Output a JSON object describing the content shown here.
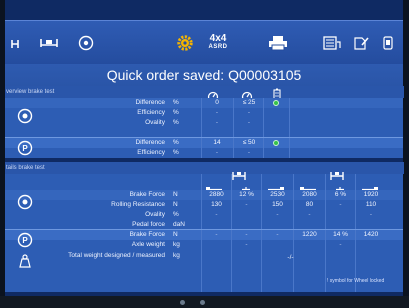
{
  "toolbar": {
    "items": [
      {
        "icon": "lift-icon"
      },
      {
        "icon": "vehicle-axle-icon"
      },
      {
        "icon": "brake-disc-icon"
      },
      {
        "icon": "gear-icon"
      },
      {
        "icon": "4x4-asrd-logo",
        "label_top": "4x4",
        "label_bottom": "ASRD"
      },
      {
        "icon": "printer-icon"
      },
      {
        "icon": "list-icon"
      },
      {
        "icon": "document-edit-icon"
      },
      {
        "icon": "phone-icon"
      }
    ],
    "accent": "#f5b400"
  },
  "title": "Quick order saved: Q00003105",
  "overview": {
    "heading": "verview brake test",
    "rows": [
      {
        "label": "Difference",
        "unit": "%",
        "c1": "0",
        "c2": "≤ 25",
        "status": "green"
      },
      {
        "label": "Efficiency",
        "unit": "%",
        "c1": "-",
        "c2": "-",
        "status": ""
      },
      {
        "label": "Ovality",
        "unit": "%",
        "c1": "-",
        "c2": "-",
        "status": ""
      },
      {
        "label": "Difference",
        "unit": "%",
        "c1": "14",
        "c2": "≤ 50",
        "status": "green"
      },
      {
        "label": "Efficiency",
        "unit": "%",
        "c1": "-",
        "c2": "-",
        "status": ""
      }
    ]
  },
  "details": {
    "heading": "tails brake test",
    "rows": [
      {
        "label": "Brake Force",
        "unit": "N",
        "cells": [
          "2880",
          "12 %",
          "2530",
          "2080",
          "6 %",
          "1920"
        ]
      },
      {
        "label": "Rolling Resistance",
        "unit": "N",
        "cells": [
          "130",
          "-",
          "150",
          "80",
          "-",
          "110"
        ]
      },
      {
        "label": "Ovality",
        "unit": "%",
        "cells": [
          "-",
          "",
          "-",
          "-",
          "",
          "-"
        ]
      },
      {
        "label": "Pedal force",
        "unit": "daN",
        "cells": [
          "",
          "",
          "",
          "",
          "",
          ""
        ]
      },
      {
        "label": "Brake Force",
        "unit": "N",
        "cells": [
          "-",
          "-",
          "-",
          "1220",
          "14 %",
          "1420"
        ]
      },
      {
        "label": "Axle weight",
        "unit": "kg",
        "cells": [
          "",
          "-",
          "",
          "",
          "-",
          ""
        ]
      },
      {
        "label": "Total weight designed / measured",
        "unit": "kg",
        "cells": [
          "",
          "",
          "",
          "",
          "-/-",
          ""
        ]
      }
    ],
    "footnote": "! symbol for Wheel locked"
  },
  "colors": {
    "background": "#0f2a63",
    "panel": "#2d5db4",
    "ok": "#36c24a"
  }
}
